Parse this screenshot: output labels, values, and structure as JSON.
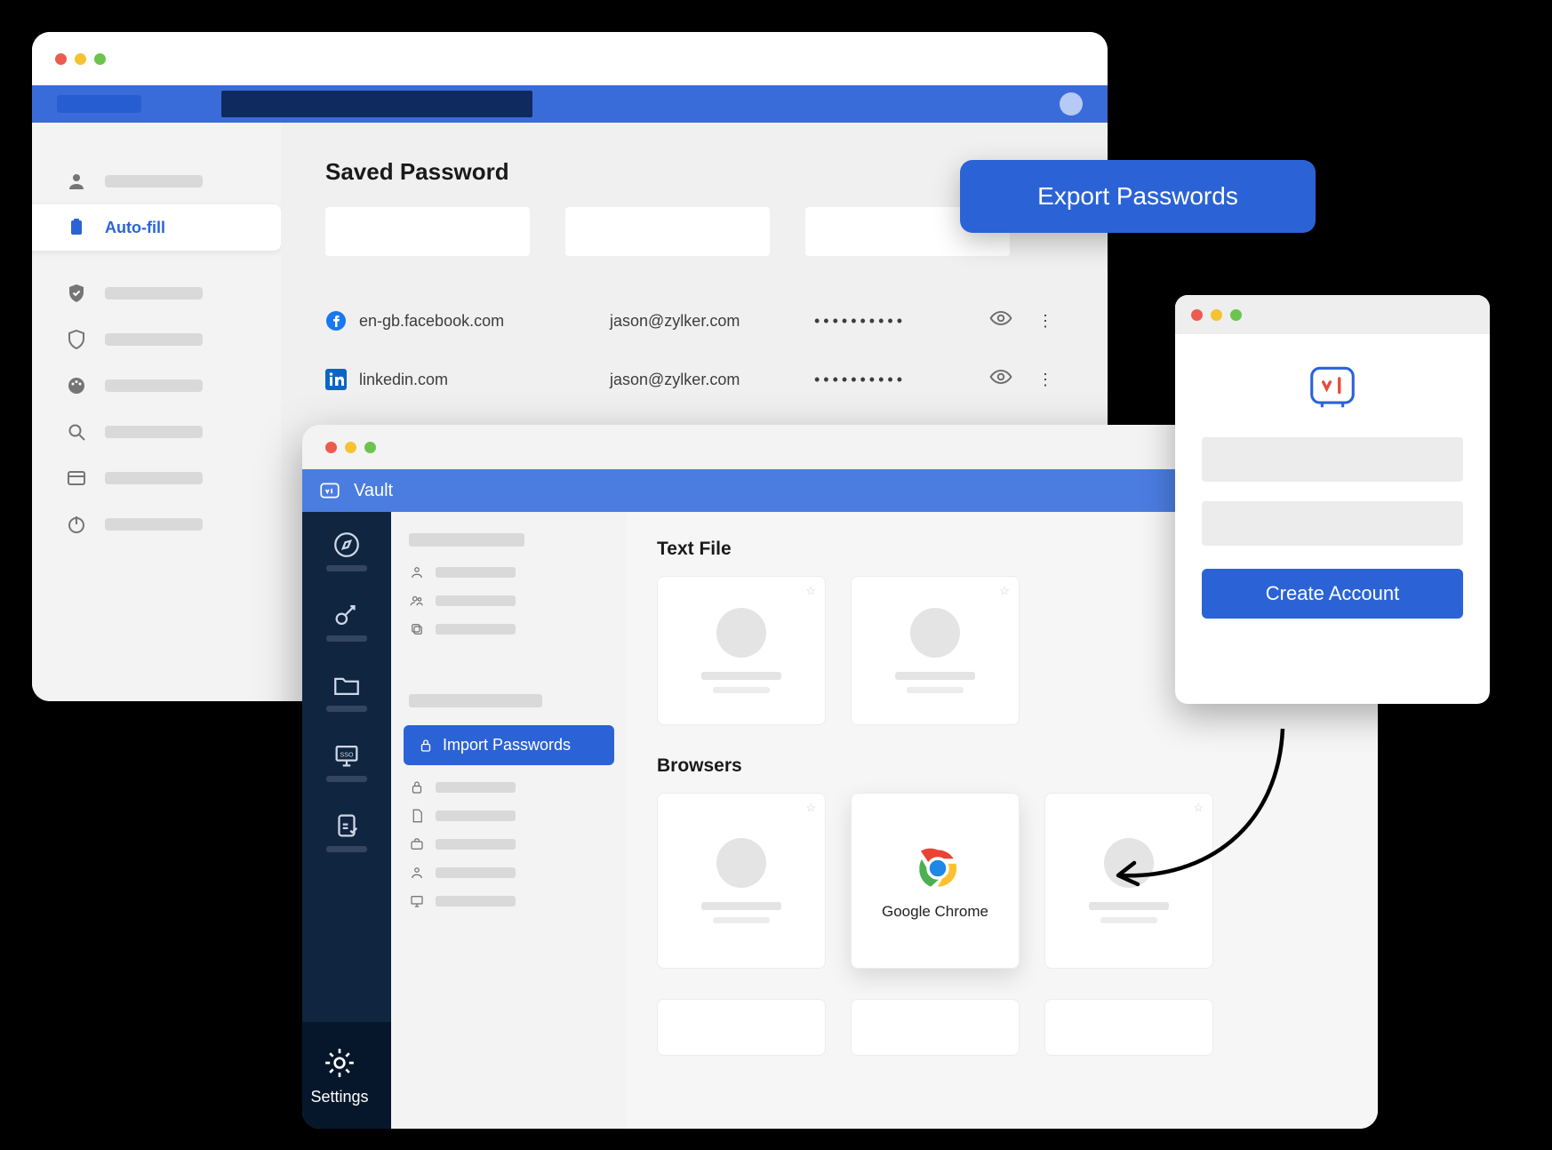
{
  "chrome": {
    "title": "Saved Password",
    "sidebar": {
      "autofill_label": "Auto-fill"
    },
    "rows": [
      {
        "site": "en-gb.facebook.com",
        "user": "jason@zylker.com",
        "password": "••••••••••"
      },
      {
        "site": "linkedin.com",
        "user": "jason@zylker.com",
        "password": "••••••••••"
      }
    ]
  },
  "export_button": "Export Passwords",
  "vault": {
    "app_name": "Vault",
    "settings_label": "Settings",
    "import_label": "Import Passwords",
    "sections": {
      "text_file": "Text File",
      "browsers": "Browsers"
    },
    "chrome_tile": "Google Chrome"
  },
  "signup": {
    "cta": "Create Account"
  }
}
